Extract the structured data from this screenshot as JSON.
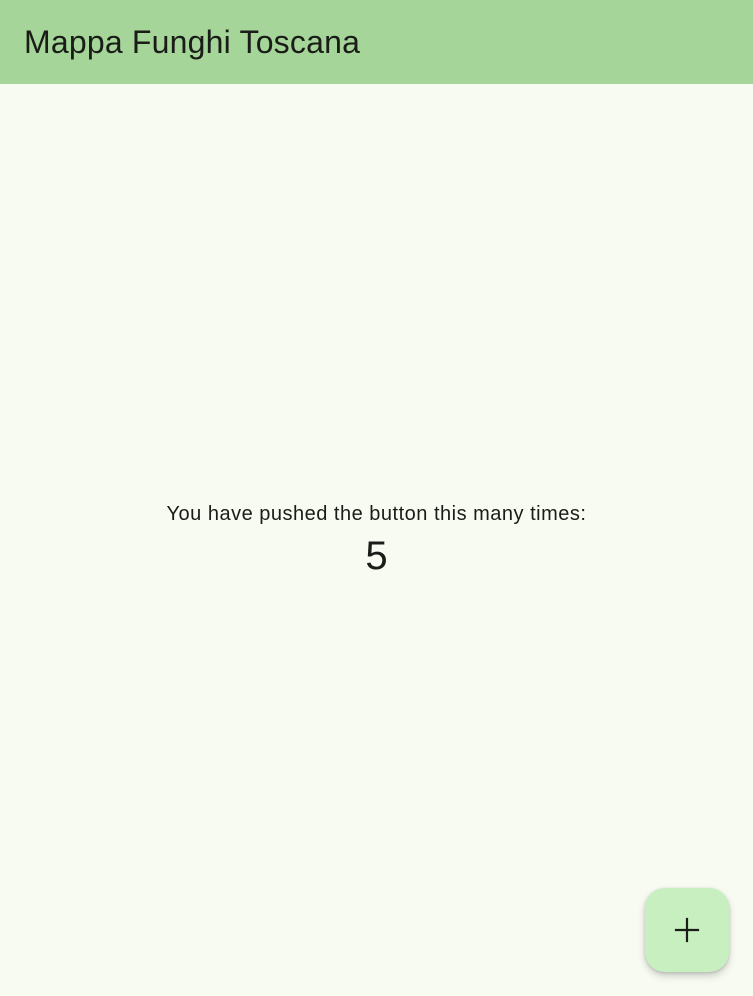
{
  "app_bar": {
    "title": "Mappa Funghi Toscana",
    "background_color": "#a5d598"
  },
  "main": {
    "message": "You have pushed the button this many times:",
    "counter": "5",
    "background_color": "#f7fbf1"
  },
  "fab": {
    "icon": "add-icon",
    "background_color": "#c8efbf"
  }
}
